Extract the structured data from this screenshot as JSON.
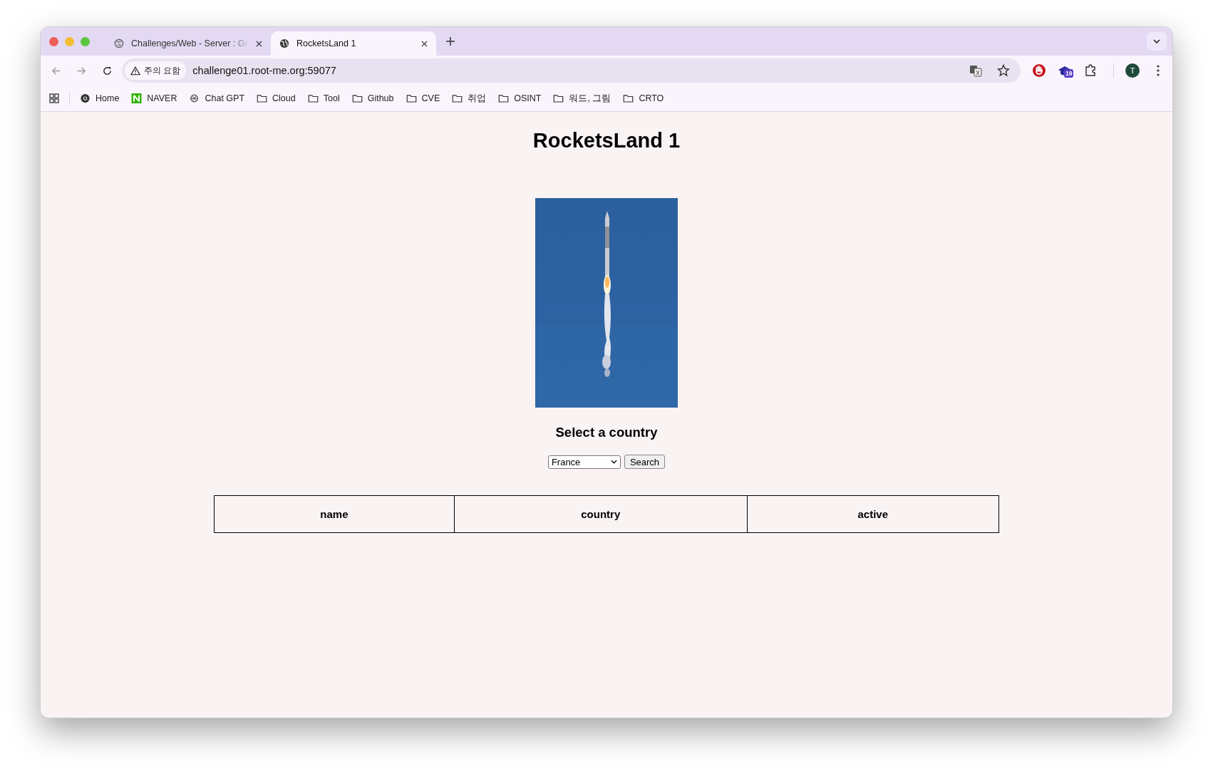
{
  "browser": {
    "tabs": [
      {
        "title": "Challenges/Web - Server : Gr",
        "selected": false,
        "kind": "site"
      },
      {
        "title": "RocketsLand 1",
        "selected": true,
        "kind": "globe"
      }
    ],
    "address": {
      "security_label": "주의 요함",
      "url": "challenge01.root-me.org:59077"
    },
    "extension_badge": "19",
    "profile_initial": "T",
    "bookmarks": [
      {
        "label": "Home",
        "kind": "chrome"
      },
      {
        "label": "NAVER",
        "kind": "naver"
      },
      {
        "label": "Chat GPT",
        "kind": "gpt"
      },
      {
        "label": "Cloud",
        "kind": "folder"
      },
      {
        "label": "Tool",
        "kind": "folder"
      },
      {
        "label": "Github",
        "kind": "folder"
      },
      {
        "label": "CVE",
        "kind": "folder"
      },
      {
        "label": "취업",
        "kind": "folder"
      },
      {
        "label": "OSINT",
        "kind": "folder"
      },
      {
        "label": "워드, 그림",
        "kind": "folder"
      },
      {
        "label": "CRTO",
        "kind": "folder"
      }
    ]
  },
  "page": {
    "title": "RocketsLand 1",
    "subtitle": "Select a country",
    "country_select": {
      "value": "France"
    },
    "search_button": "Search",
    "table": {
      "columns": [
        "name",
        "country",
        "active"
      ]
    }
  }
}
